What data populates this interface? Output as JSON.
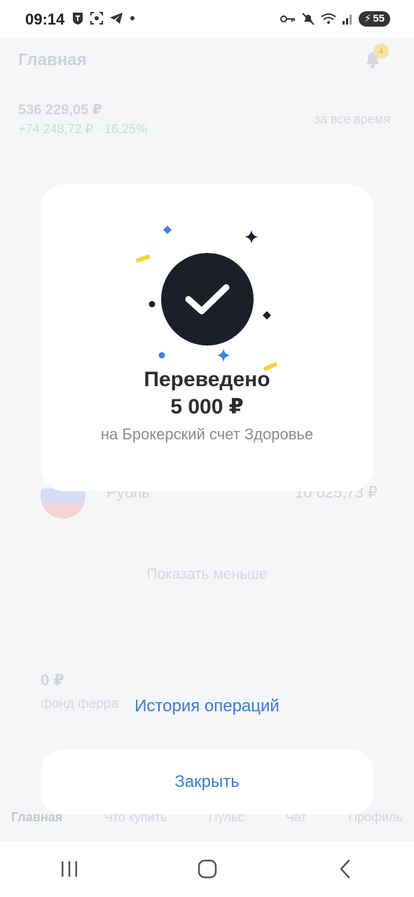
{
  "status_bar": {
    "time": "09:14",
    "battery_level": "55",
    "left_icons": [
      "tinkoff-icon",
      "screenshot-icon",
      "telegram-icon",
      "dot-icon"
    ],
    "right_icons": [
      "key-icon",
      "mute-icon",
      "wifi-icon",
      "signal-icon",
      "battery-icon"
    ]
  },
  "background": {
    "title": "Главная",
    "notification_count": "4",
    "balance": "536 229,05 ₽",
    "profit": "+74 248,72 ₽ · 16,25%",
    "period": "за все время",
    "currency_name": "Рубль",
    "currency_value": "10 025,73 ₽",
    "show_less": "Показать меньше",
    "fund_amount": "0 ₽",
    "fund_name": "фонд ферра",
    "nav": [
      "Главная",
      "Что купить",
      "Пульс",
      "Чат",
      "Профиль"
    ]
  },
  "dialog": {
    "title": "Переведено",
    "amount": "5 000 ₽",
    "subtitle": "на Брокерский счет Здоровье",
    "history_link": "История операций",
    "close_label": "Закрыть"
  },
  "colors": {
    "accent": "#3a7bd5",
    "check_bg": "#1b1f2a",
    "confetti_blue": "#3b82e6",
    "confetti_yellow": "#f4d33b",
    "confetti_dark": "#1b1f2a"
  }
}
